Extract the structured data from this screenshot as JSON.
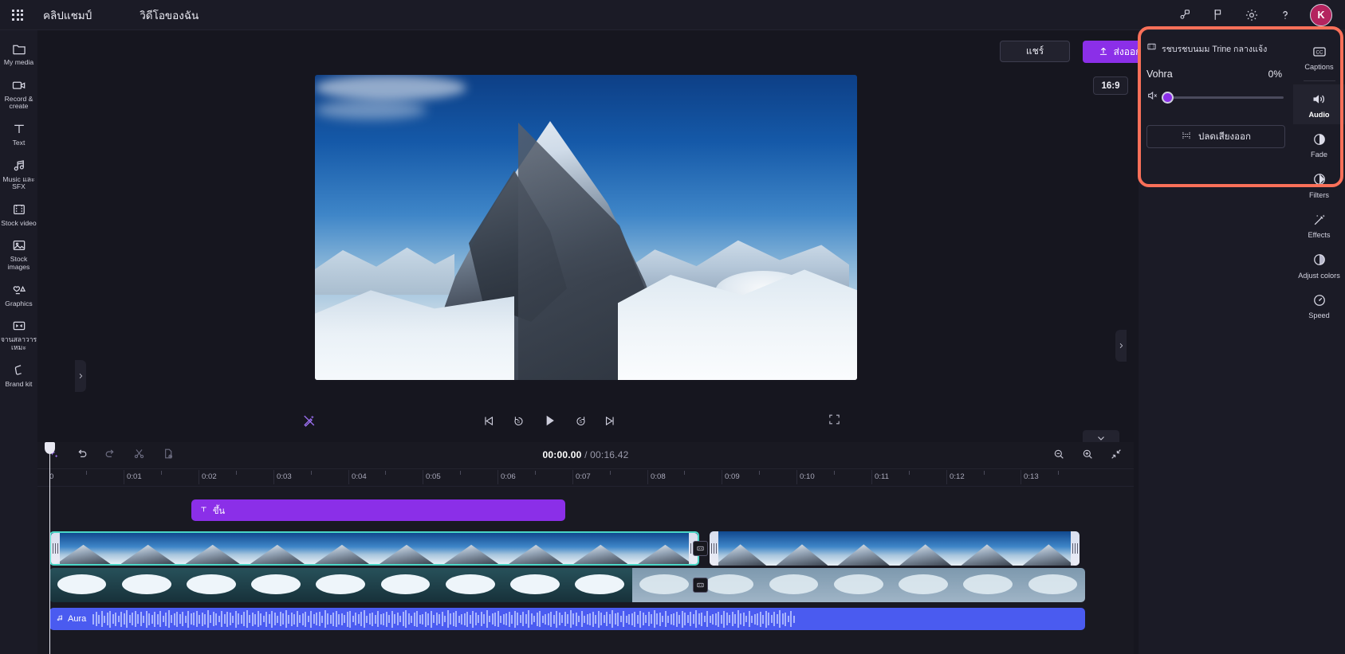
{
  "topbar": {
    "waffle_icon": "app-launcher-icon",
    "brand": "คลิปแชมป์",
    "project_name": "วิดีโอของฉัน",
    "icons": [
      {
        "name": "share-graph-icon",
        "label": "share-graph"
      },
      {
        "name": "flag-icon",
        "label": "flag"
      },
      {
        "name": "gear-icon",
        "label": "settings"
      },
      {
        "name": "help-icon",
        "label": "help"
      }
    ],
    "avatar_initial": "K",
    "avatar_color": "#b4245f"
  },
  "left_rail": {
    "items": [
      {
        "icon": "folder-icon",
        "label": "My media"
      },
      {
        "icon": "camera-icon",
        "label": "Record & create"
      },
      {
        "icon": "text-icon",
        "label": "Text"
      },
      {
        "icon": "music-note-icon",
        "label": "Music และ SFX"
      },
      {
        "icon": "film-strip-icon",
        "label": "Stock video"
      },
      {
        "icon": "image-icon",
        "label": "Stock images"
      },
      {
        "icon": "shapes-icon",
        "label": "Graphics"
      },
      {
        "icon": "transition-icon",
        "label": "จานสลาวารเหมะ"
      },
      {
        "icon": "brand-kit-icon",
        "label": "Brand kit"
      }
    ]
  },
  "preview": {
    "share_label": "แชร์",
    "export_label": "ส่งออก",
    "export_icon": "upload-icon",
    "aspect_ratio": "16:9",
    "magic_tool_icon": "magic-eraser-icon",
    "transport": [
      {
        "icon": "skip-previous-icon",
        "name": "jump-to-start"
      },
      {
        "icon": "rewind-5s-icon",
        "name": "rewind-5-seconds"
      },
      {
        "icon": "play-icon",
        "name": "play"
      },
      {
        "icon": "forward-5s-icon",
        "name": "forward-5-seconds"
      },
      {
        "icon": "skip-next-icon",
        "name": "jump-to-end"
      }
    ],
    "fullscreen_icon": "fullscreen-icon",
    "collapse_icon": "chevron-down-icon",
    "left_expand_icon": "chevron-right-icon",
    "right_expand_icon": "chevron-right-icon"
  },
  "properties_panel": {
    "clip_icon": "film-strip-icon",
    "clip_title": "รชบรชบนมม Trine กลางแจ้ง",
    "property_name": "Vohra",
    "property_value": "0%",
    "mute_icon": "speaker-muted-icon",
    "slider_position_pct": 0,
    "detach_icon": "detach-audio-icon",
    "detach_label": "ปลดเสียงออก",
    "accent_color": "#8b2fe8",
    "highlight_color": "#fa7059"
  },
  "right_rail": {
    "items": [
      {
        "icon": "captions-icon",
        "label": "Captions",
        "active": false
      },
      {
        "icon": "speaker-icon",
        "label": "Audio",
        "active": true
      },
      {
        "icon": "fade-icon",
        "label": "Fade",
        "active": false
      },
      {
        "icon": "filters-icon",
        "label": "Filters",
        "active": false
      },
      {
        "icon": "effects-wand-icon",
        "label": "Effects",
        "active": false
      },
      {
        "icon": "adjust-colors-icon",
        "label": "Adjust colors",
        "active": false
      },
      {
        "icon": "speed-gauge-icon",
        "label": "Speed",
        "active": false
      }
    ]
  },
  "timeline": {
    "tools": [
      {
        "icon": "magic-sparkle-icon",
        "name": "magic-tools"
      },
      {
        "icon": "undo-icon",
        "name": "undo"
      },
      {
        "icon": "redo-icon",
        "name": "redo"
      },
      {
        "icon": "scissors-icon",
        "name": "split"
      },
      {
        "icon": "duplicate-icon",
        "name": "duplicate"
      }
    ],
    "current_time": "00:00.00",
    "separator": "/",
    "total_time": "00:16.42",
    "zoom_controls": [
      {
        "icon": "zoom-out-icon",
        "name": "zoom-out"
      },
      {
        "icon": "zoom-in-icon",
        "name": "zoom-in"
      },
      {
        "icon": "fit-icon",
        "name": "fit-to-screen"
      }
    ],
    "ruler_ticks": [
      "0",
      "0:01",
      "0:02",
      "0:03",
      "0:04",
      "0:05",
      "0:06",
      "0:07",
      "0:08",
      "0:09",
      "0:10",
      "0:11",
      "0:12",
      "0:13"
    ],
    "playhead_time": "0",
    "tracks": {
      "text_clip": {
        "icon": "text-icon",
        "label": "ขึ้น"
      },
      "video_clip_1": {
        "name": "video-clip-mountain-1"
      },
      "video_clip_2": {
        "name": "video-clip-mountain-2"
      },
      "transition_badge_1": {
        "icon": "transition-icon"
      },
      "transition_badge_2": {
        "icon": "transition-icon"
      },
      "overlay_clip": {
        "name": "overlay-clip-snow"
      },
      "audio_clip": {
        "icon": "music-note-icon",
        "label": "Aura"
      }
    }
  }
}
